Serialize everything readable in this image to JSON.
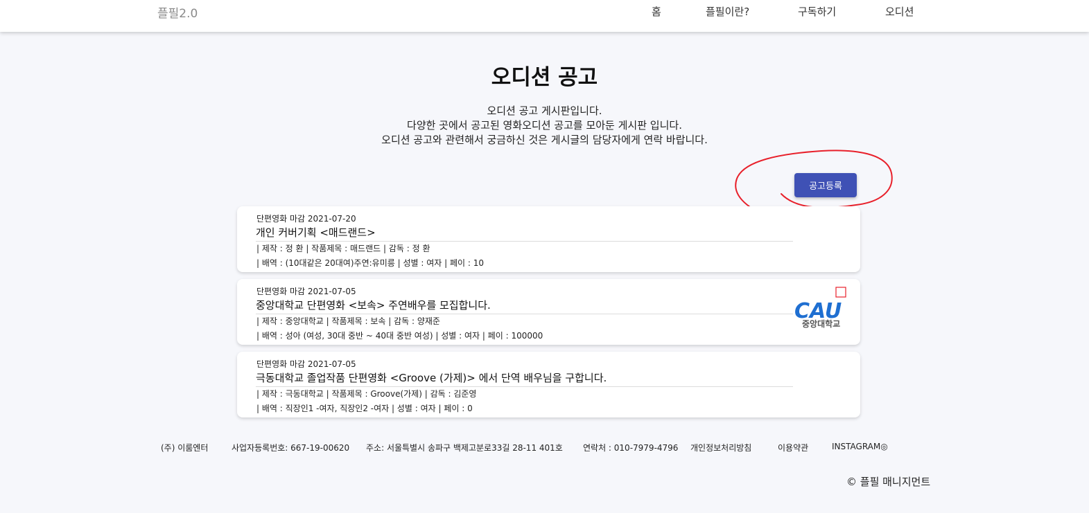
{
  "header": {
    "brand": "플필2.0",
    "nav": [
      "홈",
      "플필이란?",
      "구독하기",
      "오디션"
    ]
  },
  "main": {
    "title": "오디션 공고",
    "intro": [
      "오디션 공고 게시판입니다.",
      "다양한 곳에서 공고된 영화오디션 공고를 모아둔 게시판 입니다.",
      "오디션 공고와 관련해서 궁금하신 것은 게시글의 담당자에게 연락 바랍니다."
    ],
    "register_label": "공고등록",
    "annotation_color": "#e8202a",
    "posts": [
      {
        "meta": "단편영화 마감 2021-07-20",
        "title": "개인 커버기획 <매드랜드>",
        "line1": "| 제작 : 정 환 | 작품제목 : 매드랜드 | 감독 : 정 환",
        "line2": "| 배역 : (10대같은 20대여)주연:유미릉 | 성별 : 여자 | 페이 : 10",
        "logo": null
      },
      {
        "meta": "단편영화 마감 2021-07-05",
        "title": "중앙대학교 단편영화 <보속> 주연배우를 모집합니다.",
        "line1": "| 제작 : 중앙대학교 | 작품제목 : 보속 | 감독 : 양재준",
        "line2": "| 배역 : 성아 (여성, 30대 중반 ~ 40대 중반 여성) | 성별 : 여자 | 페이 : 100000",
        "logo": {
          "mark": "CAU",
          "caption": "중앙대학교",
          "color": "#1f6fd1"
        }
      },
      {
        "meta": "단편영화 마감 2021-07-05",
        "title": "극동대학교 졸업작품 단편영화 <Groove (가제)> 에서 단역 배우님을 구합니다.",
        "line1": "| 제작 : 극동대학교 | 작품제목 : Groove(가제) | 감독 : 김준영",
        "line2": "| 배역 : 직장인1 -여자, 직장인2 -여자 | 성별 : 여자 | 페이 : 0",
        "logo": null
      }
    ]
  },
  "footer": {
    "company": "(주) 이룸엔터",
    "registration": "사업자등록번호: 667-19-00620",
    "address": "주소: 서울특별시 송파구 백제고분로33길 28-11 401호",
    "contact": "연락처 : 010-7979-4796",
    "privacy": "개인정보처리방침",
    "terms": "이용약관",
    "instagram": "INSTAGRAM◎",
    "copyright": "© 플필 매니지먼트"
  },
  "colors": {
    "accent": "#3f51b5",
    "background": "#f6f7fb"
  }
}
